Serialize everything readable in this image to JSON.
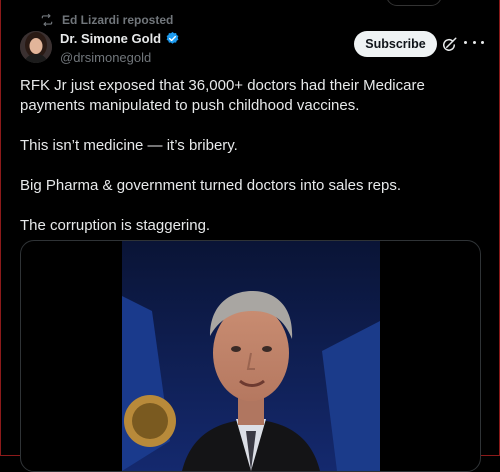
{
  "repost": {
    "label": "Ed Lizardi reposted",
    "icon": "repost-icon"
  },
  "author": {
    "name": "Dr. Simone Gold",
    "handle": "@drsimonegold",
    "verified": true,
    "verified_color": "#1d9bf0"
  },
  "actions": {
    "subscribe_label": "Subscribe",
    "grok_icon": "grok-icon",
    "more_icon": "more-icon"
  },
  "post": {
    "paragraphs": [
      "RFK Jr just exposed that 36,000+ doctors had their Medicare payments manipulated to push childhood vaccines.",
      "This isn’t medicine — it’s bribery.",
      "Big Pharma & government turned doctors into sales reps.",
      "The corruption is staggering."
    ]
  },
  "media": {
    "type": "video"
  },
  "colors": {
    "background": "#000000",
    "text": "#e7e9ea",
    "muted": "#71767b",
    "accent": "#1d9bf0",
    "button_bg": "#eff3f4"
  }
}
